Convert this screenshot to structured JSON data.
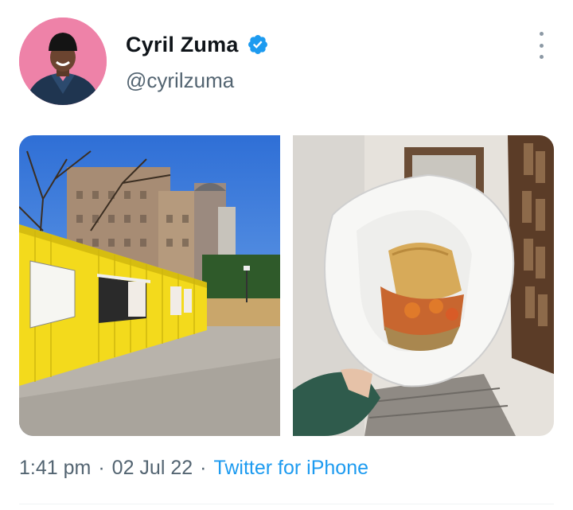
{
  "author": {
    "display_name": "Cyril Zuma",
    "handle": "@cyrilzuma",
    "verified": true,
    "avatar_bg": "#ee82a8"
  },
  "icons": {
    "verified": "verified-badge-icon",
    "more": "more-vertical-icon"
  },
  "media": [
    {
      "name": "yellow-container-photo"
    },
    {
      "name": "sandwich-photo"
    }
  ],
  "meta": {
    "time": "1:41 pm",
    "separator": "·",
    "date": "02 Jul 22",
    "source": "Twitter for iPhone"
  },
  "colors": {
    "link": "#1d9bf0",
    "verified": "#1d9bf0",
    "muted": "#536471"
  }
}
